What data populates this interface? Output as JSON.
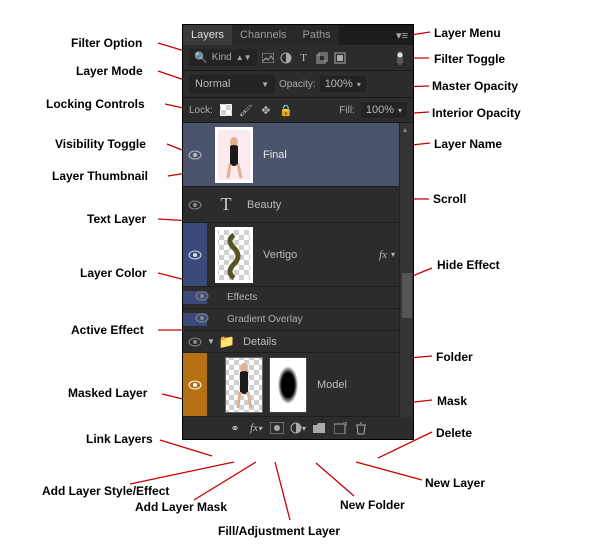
{
  "tabs": {
    "layers": "Layers",
    "channels": "Channels",
    "paths": "Paths"
  },
  "filter": {
    "kind_icon": "🔍",
    "kind_label": "Kind"
  },
  "blend": {
    "mode": "Normal",
    "opacity_label": "Opacity:",
    "opacity": "100%"
  },
  "lock": {
    "label": "Lock:",
    "fill_label": "Fill:",
    "fill": "100%"
  },
  "layers": {
    "final": {
      "name": "Final"
    },
    "beauty": {
      "name": "Beauty"
    },
    "vertigo": {
      "name": "Vertigo"
    },
    "effects": {
      "label": "Effects"
    },
    "grad": {
      "label": "Gradient Overlay"
    },
    "details": {
      "name": "Details"
    },
    "model": {
      "name": "Model"
    }
  },
  "callouts": {
    "filter_option": "Filter Option",
    "layer_mode": "Layer Mode",
    "locking_controls": "Locking Controls",
    "visibility_toggle": "Visibility Toggle",
    "layer_thumbnail": "Layer Thumbnail",
    "text_layer": "Text Layer",
    "layer_color": "Layer Color",
    "active_effect": "Active Effect",
    "masked_layer": "Masked Layer",
    "link_layers": "Link Layers",
    "add_layer_style": "Add Layer Style/Effect",
    "add_layer_mask": "Add Layer Mask",
    "fill_adjustment": "Fill/Adjustment Layer",
    "new_folder": "New Folder",
    "new_layer": "New Layer",
    "delete": "Delete",
    "mask": "Mask",
    "folder": "Folder",
    "hide_effect": "Hide Effect",
    "scroll": "Scroll",
    "layer_name": "Layer Name",
    "master_opacity": "Master Opacity",
    "interior_opacity": "Interior Opacity",
    "filter_toggle": "Filter Toggle",
    "layer_menu": "Layer Menu"
  }
}
